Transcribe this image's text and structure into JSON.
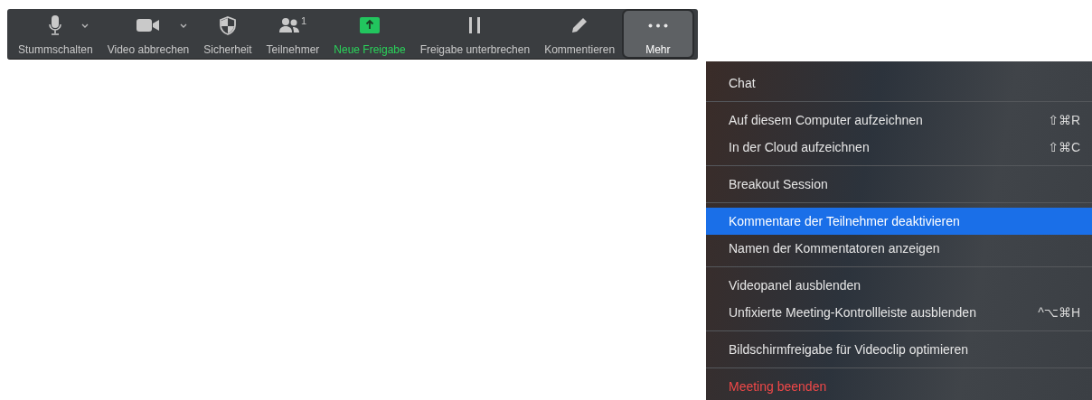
{
  "toolbar": {
    "items": [
      {
        "label": "Stummschalten",
        "selected": false,
        "active": false
      },
      {
        "label": "Video abbrechen",
        "selected": false,
        "active": false
      },
      {
        "label": "Sicherheit",
        "selected": false,
        "active": false
      },
      {
        "label": "Teilnehmer",
        "badge": "1",
        "selected": false,
        "active": false
      },
      {
        "label": "Neue Freigabe",
        "selected": false,
        "active": true
      },
      {
        "label": "Freigabe unterbrechen",
        "selected": false,
        "active": false
      },
      {
        "label": "Kommentieren",
        "selected": false,
        "active": false
      },
      {
        "label": "Mehr",
        "selected": true,
        "active": false
      }
    ]
  },
  "menu": {
    "sections": [
      {
        "items": [
          {
            "label": "Chat",
            "kind": "normal",
            "selected": false
          }
        ]
      },
      {
        "items": [
          {
            "label": "Auf diesem Computer aufzeichnen",
            "shortcut": "⇧⌘R",
            "kind": "normal",
            "selected": false
          },
          {
            "label": "In der Cloud aufzeichnen",
            "shortcut": "⇧⌘C",
            "kind": "normal",
            "selected": false
          }
        ]
      },
      {
        "items": [
          {
            "label": "Breakout Session",
            "kind": "normal",
            "selected": false
          }
        ]
      },
      {
        "items": [
          {
            "label": "Kommentare der Teilnehmer deaktivieren",
            "kind": "normal",
            "selected": true
          },
          {
            "label": "Namen der Kommentatoren anzeigen",
            "kind": "normal",
            "selected": false
          }
        ]
      },
      {
        "items": [
          {
            "label": "Videopanel ausblenden",
            "kind": "normal",
            "selected": false
          },
          {
            "label": "Unfixierte Meeting-Kontrollleiste ausblenden",
            "shortcut": "^⌥⌘H",
            "kind": "normal",
            "selected": false
          }
        ]
      },
      {
        "items": [
          {
            "label": "Bildschirmfreigabe für Videoclip optimieren",
            "kind": "normal",
            "selected": false
          }
        ]
      },
      {
        "items": [
          {
            "label": "Meeting beenden",
            "kind": "danger",
            "selected": false
          }
        ]
      }
    ]
  }
}
